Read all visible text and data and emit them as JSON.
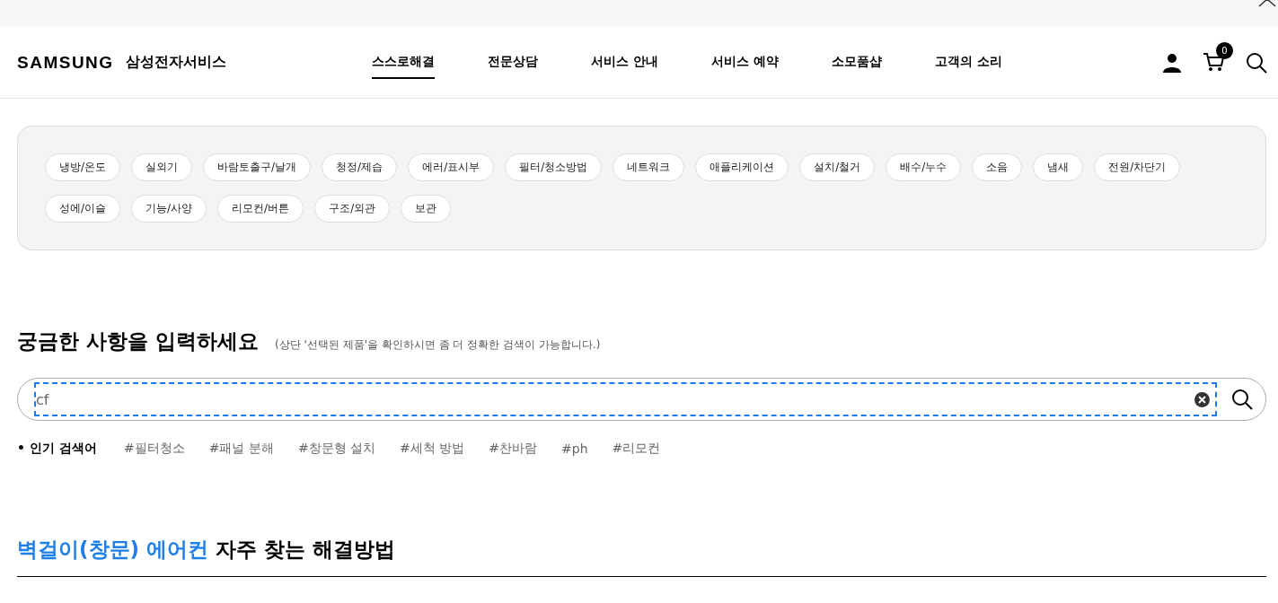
{
  "header": {
    "brand": "SAMSUNG",
    "brand_sub": "삼성전자서비스",
    "nav": [
      {
        "label": "스스로해결",
        "selected": true
      },
      {
        "label": "전문상담",
        "selected": false
      },
      {
        "label": "서비스 안내",
        "selected": false
      },
      {
        "label": "서비스 예약",
        "selected": false
      },
      {
        "label": "소모품샵",
        "selected": false
      },
      {
        "label": "고객의 소리",
        "selected": false
      }
    ],
    "cart_count": "0"
  },
  "categories": [
    {
      "label": "냉방/온도",
      "selected": false
    },
    {
      "label": "실외기",
      "selected": false
    },
    {
      "label": "바람토출구/날개",
      "selected": false
    },
    {
      "label": "청정/제습",
      "selected": false
    },
    {
      "label": "에러/표시부",
      "selected": false
    },
    {
      "label": "필터/청소방법",
      "selected": false
    },
    {
      "label": "네트워크",
      "selected": false
    },
    {
      "label": "애플리케이션",
      "selected": false
    },
    {
      "label": "설치/철거",
      "selected": false
    },
    {
      "label": "배수/누수",
      "selected": false
    },
    {
      "label": "소음",
      "selected": false
    },
    {
      "label": "냄새",
      "selected": false
    },
    {
      "label": "전원/차단기",
      "selected": false
    },
    {
      "label": "성에/이슬",
      "selected": false
    },
    {
      "label": "기능/사양",
      "selected": false
    },
    {
      "label": "리모컨/버튼",
      "selected": false
    },
    {
      "label": "구조/외관",
      "selected": false
    },
    {
      "label": "보관",
      "selected": false
    }
  ],
  "search": {
    "title": "궁금한 사항을 입력하세요",
    "hint": "(상단 '선택된 제품'을 확인하시면 좀 더 정확한 검색이 가능합니다.)",
    "value": "cf"
  },
  "popular": {
    "label": "• 인기 검색어",
    "keywords": [
      "#필터청소",
      "#패널 분해",
      "#창문형 설치",
      "#세척 방법",
      "#찬바람",
      "#ph",
      "#리모컨"
    ]
  },
  "section": {
    "title_highlight": "벽걸이(창문) 에어컨",
    "title_rest": " 자주 찾는 해결방법"
  }
}
